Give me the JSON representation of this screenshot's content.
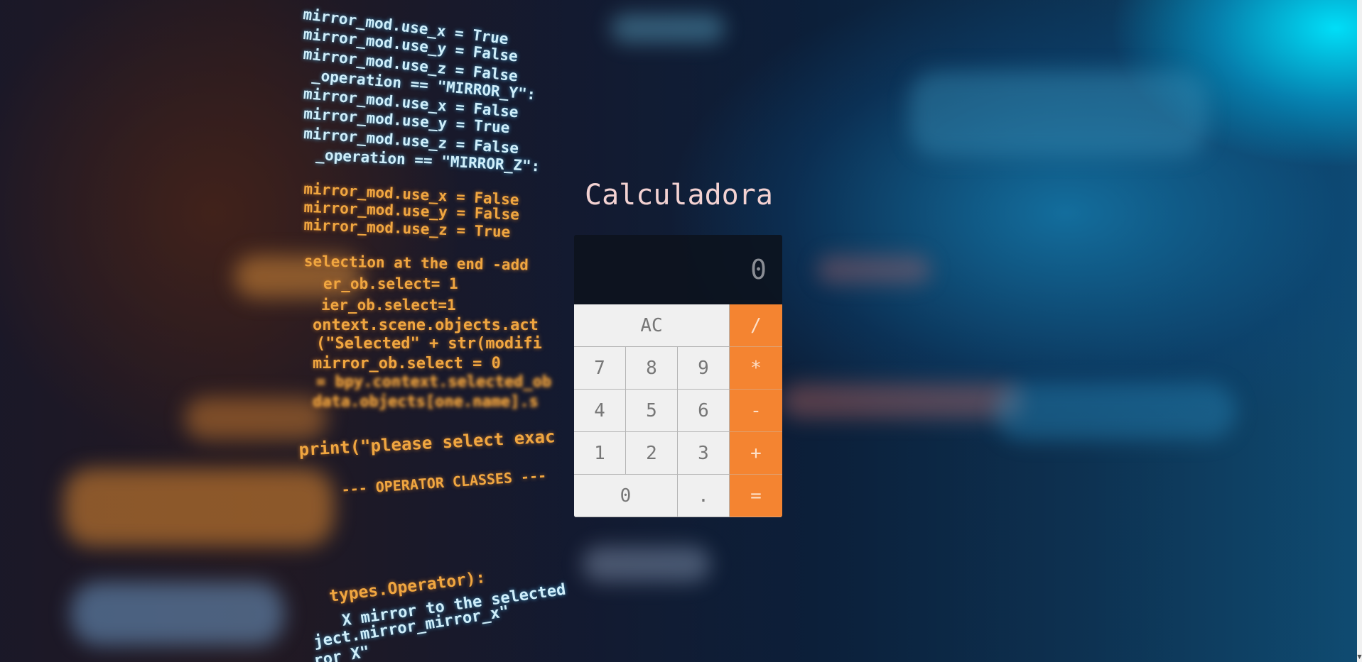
{
  "page": {
    "title": "Calculadora"
  },
  "display": {
    "value": "0"
  },
  "keys": [
    {
      "label": "AC",
      "name": "clear-button",
      "type": "fn",
      "span": 3
    },
    {
      "label": "/",
      "name": "divide-button",
      "type": "op"
    },
    {
      "label": "7",
      "name": "digit-7-button",
      "type": "num"
    },
    {
      "label": "8",
      "name": "digit-8-button",
      "type": "num"
    },
    {
      "label": "9",
      "name": "digit-9-button",
      "type": "num"
    },
    {
      "label": "*",
      "name": "multiply-button",
      "type": "op"
    },
    {
      "label": "4",
      "name": "digit-4-button",
      "type": "num"
    },
    {
      "label": "5",
      "name": "digit-5-button",
      "type": "num"
    },
    {
      "label": "6",
      "name": "digit-6-button",
      "type": "num"
    },
    {
      "label": "-",
      "name": "subtract-button",
      "type": "op"
    },
    {
      "label": "1",
      "name": "digit-1-button",
      "type": "num"
    },
    {
      "label": "2",
      "name": "digit-2-button",
      "type": "num"
    },
    {
      "label": "3",
      "name": "digit-3-button",
      "type": "num"
    },
    {
      "label": "+",
      "name": "add-button",
      "type": "op"
    },
    {
      "label": "0",
      "name": "digit-0-button",
      "type": "num",
      "span": 2
    },
    {
      "label": ".",
      "name": "decimal-button",
      "type": "num"
    },
    {
      "label": "=",
      "name": "equals-button",
      "type": "op"
    }
  ],
  "background": {
    "code_lines_cyan": [
      "mirror_mod.use_x = True",
      "mirror_mod.use_y = False",
      "mirror_mod.use_z = False",
      "_operation == \"MIRROR_Y\":",
      "mirror_mod.use_x = False",
      "mirror_mod.use_y = True",
      "mirror_mod.use_z = False",
      "_operation == \"MIRROR_Z\":"
    ],
    "code_lines_orange": [
      "mirror_mod.use_x = False",
      "mirror_mod.use_y = False",
      "mirror_mod.use_z = True",
      "selection at the end -add",
      "er_ob.select= 1",
      "ier_ob.select=1",
      "ontext.scene.objects.act",
      "(\"Selected\" + str(modifi",
      "mirror_ob.select = 0",
      "= bpy.context.selected_ob",
      "data.objects[one.name].s",
      "print(\"please select exac",
      "--- OPERATOR CLASSES ---",
      "types.Operator):",
      "X mirror to the selected",
      "ject.mirror_mirror_x\"",
      "ror X\""
    ]
  },
  "colors": {
    "operator_key": "#f48431",
    "number_key": "#f0f0f0",
    "display_bg": "#0c121c",
    "title_text": "#f3d2d2"
  }
}
